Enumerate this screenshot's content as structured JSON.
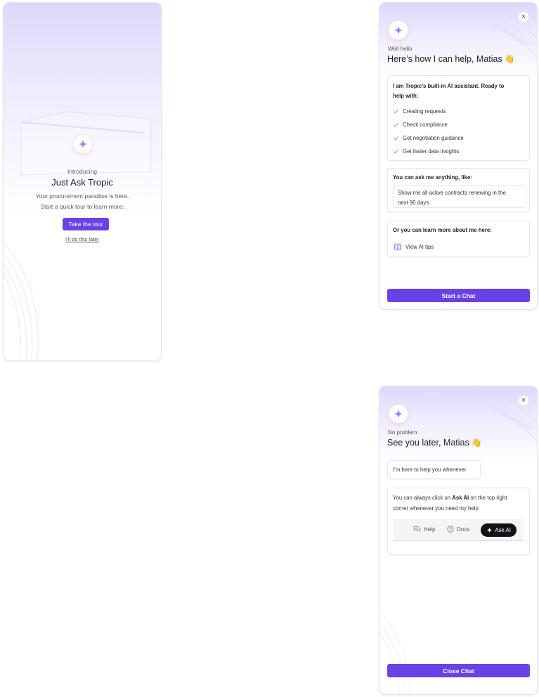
{
  "intro": {
    "eyebrow": "Introducing",
    "title": "Just Ask Tropic",
    "subtitle_line1": "Your procurement paradise is here.",
    "subtitle_line2": "Start a quick tour to learn more:",
    "primary_button": "Take the tour",
    "secondary_link": "I’ll do this later",
    "icon": "sparkle-icon"
  },
  "help_panel": {
    "close_icon": "close-icon",
    "eyebrow": "Well hello",
    "title": "Here’s how I can help, Matias",
    "title_emoji": "👋",
    "capabilities": {
      "title_line1": "I am Tropic’s built-in AI assistant. Ready to",
      "title_line2": "help with:",
      "items": [
        "Creating requests",
        "Check compliance",
        "Get negotiation guidance",
        "Get faster data insights"
      ]
    },
    "ask": {
      "title": "You can ask me anything, like:",
      "example_line1": "Show me all active contracts renewing in the",
      "example_line2": "next 90 days"
    },
    "learn": {
      "title": "Or you can learn more about me here:",
      "link": "View AI tips",
      "link_icon": "book-icon"
    },
    "primary_button": "Start a Chat"
  },
  "bye_panel": {
    "close_icon": "close-icon",
    "eyebrow": "No problem",
    "title": "See you later, Matias",
    "title_emoji": "👋",
    "message": "I’m here to help you whenever",
    "hint_prefix": "You can always click on ",
    "hint_bold": "Ask AI",
    "hint_suffix_line1": " on the top right",
    "hint_line2": "corner whenever you need my help",
    "mini_toolbar": {
      "help_label": "Help",
      "help_icon": "chat-bubbles-icon",
      "docs_label": "Docs",
      "docs_icon": "question-circle-icon",
      "ask_label": "Ask AI",
      "ask_icon": "sparkle-icon"
    },
    "primary_button": "Close Chat"
  },
  "colors": {
    "accent": "#6a41e8",
    "gradient_top": "#dcd8fb",
    "ask_pill": "#111116"
  }
}
